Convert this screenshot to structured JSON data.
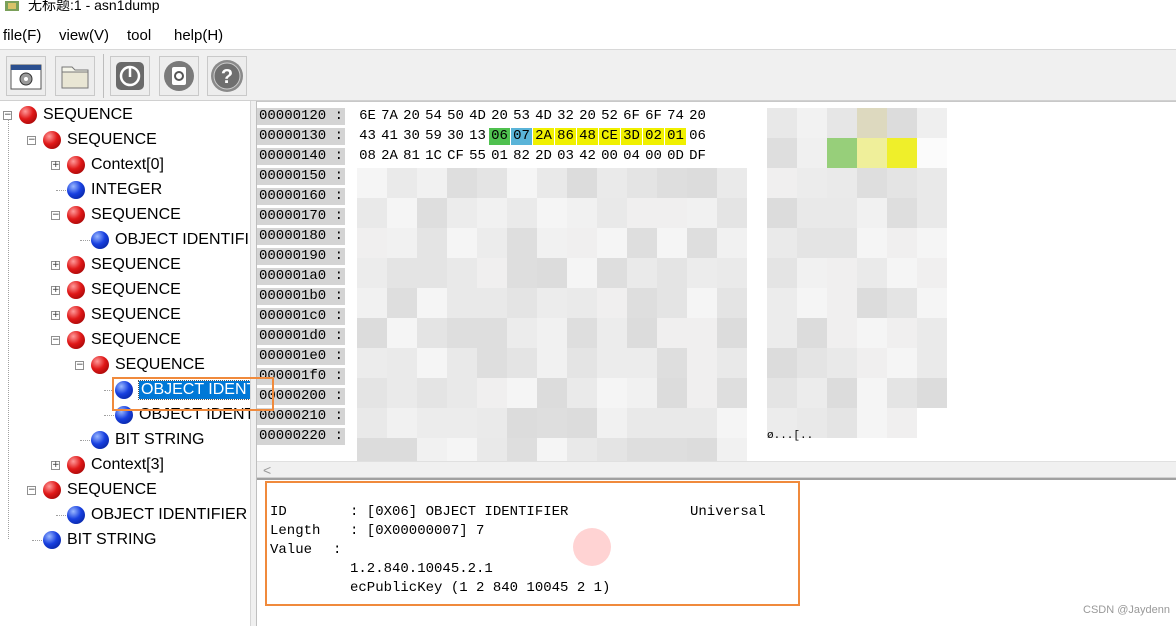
{
  "window": {
    "title": "无标题:1 - asn1dump"
  },
  "menu": [
    "file(F)",
    "view(V)",
    "tool",
    "help(H)"
  ],
  "toolbar": {
    "buttons": [
      {
        "icon": "settings-window-icon"
      },
      {
        "icon": "folder-icon"
      },
      {
        "icon": "power-icon"
      },
      {
        "icon": "recycle-icon"
      },
      {
        "icon": "help-icon"
      }
    ]
  },
  "tree": [
    {
      "label": "SEQUENCE",
      "color": "red",
      "level": 0,
      "expander": "-"
    },
    {
      "label": "SEQUENCE",
      "color": "red",
      "level": 1,
      "expander": "-"
    },
    {
      "label": "Context[0]",
      "color": "red",
      "level": 2,
      "expander": "+"
    },
    {
      "label": "INTEGER",
      "color": "blue",
      "level": 2,
      "expander": ""
    },
    {
      "label": "SEQUENCE",
      "color": "red",
      "level": 2,
      "expander": "-"
    },
    {
      "label": "OBJECT IDENTIFIE",
      "color": "blue",
      "level": 3,
      "expander": ""
    },
    {
      "label": "SEQUENCE",
      "color": "red",
      "level": 2,
      "expander": "+"
    },
    {
      "label": "SEQUENCE",
      "color": "red",
      "level": 2,
      "expander": "+"
    },
    {
      "label": "SEQUENCE",
      "color": "red",
      "level": 2,
      "expander": "+"
    },
    {
      "label": "SEQUENCE",
      "color": "red",
      "level": 2,
      "expander": "-"
    },
    {
      "label": "SEQUENCE",
      "color": "red",
      "level": 3,
      "expander": "-"
    },
    {
      "label": "OBJECT IDENT",
      "color": "blue",
      "level": 4,
      "expander": "",
      "selected": true
    },
    {
      "label": "OBJECT IDENT",
      "color": "blue",
      "level": 4,
      "expander": ""
    },
    {
      "label": "BIT STRING",
      "color": "blue",
      "level": 3,
      "expander": ""
    },
    {
      "label": "Context[3]",
      "color": "red",
      "level": 2,
      "expander": "+"
    },
    {
      "label": "SEQUENCE",
      "color": "red",
      "level": 1,
      "expander": "-"
    },
    {
      "label": "OBJECT IDENTIFIER",
      "color": "blue",
      "level": 2,
      "expander": ""
    },
    {
      "label": "BIT STRING",
      "color": "blue",
      "level": 1,
      "expander": ""
    }
  ],
  "hex": {
    "addresses": [
      "00000120 :",
      "00000130 :",
      "00000140 :",
      "00000150 :",
      "00000160 :",
      "00000170 :",
      "00000180 :",
      "00000190 :",
      "000001a0 :",
      "000001b0 :",
      "000001c0 :",
      "000001d0 :",
      "000001e0 :",
      "000001f0 :",
      "00000200 :",
      "00000210 :",
      "00000220 :"
    ],
    "rows": [
      [
        {
          "b": "6E"
        },
        {
          "b": "7A"
        },
        {
          "b": "20"
        },
        {
          "b": "54"
        },
        {
          "b": "50"
        },
        {
          "b": "4D"
        },
        {
          "b": "20"
        },
        {
          "b": "53"
        },
        {
          "b": "4D"
        },
        {
          "b": "32"
        },
        {
          "b": "20"
        },
        {
          "b": "52"
        },
        {
          "b": "6F"
        },
        {
          "b": "6F"
        },
        {
          "b": "74"
        },
        {
          "b": "20"
        }
      ],
      [
        {
          "b": "43"
        },
        {
          "b": "41"
        },
        {
          "b": "30"
        },
        {
          "b": "59"
        },
        {
          "b": "30"
        },
        {
          "b": "13"
        },
        {
          "b": "06",
          "hl": "green"
        },
        {
          "b": "07",
          "hl": "blue"
        },
        {
          "b": "2A",
          "hl": "yellow"
        },
        {
          "b": "86",
          "hl": "yellow"
        },
        {
          "b": "48",
          "hl": "yellow"
        },
        {
          "b": "CE",
          "hl": "yellow"
        },
        {
          "b": "3D",
          "hl": "yellow"
        },
        {
          "b": "02",
          "hl": "yellow"
        },
        {
          "b": "01",
          "hl": "yellow"
        },
        {
          "b": "06"
        }
      ],
      [
        {
          "b": "08"
        },
        {
          "b": "2A"
        },
        {
          "b": "81"
        },
        {
          "b": "1C"
        },
        {
          "b": "CF"
        },
        {
          "b": "55"
        },
        {
          "b": "01"
        },
        {
          "b": "82"
        },
        {
          "b": "2D"
        },
        {
          "b": "03"
        },
        {
          "b": "42"
        },
        {
          "b": "00"
        },
        {
          "b": "04"
        },
        {
          "b": "00"
        },
        {
          "b": "0D"
        },
        {
          "b": "DF"
        }
      ]
    ],
    "ascii_tail": "ø...[..",
    "highlight_colors": {
      "green": "#4fc14f",
      "blue": "#5ab4d8",
      "yellow": "#f0f000"
    }
  },
  "detail": {
    "id_label": "ID",
    "id_value": ": [0X06] OBJECT IDENTIFIER",
    "id_class": "Universal",
    "length_label": "Length",
    "length_value": ": [0X00000007] 7",
    "value_label": "Value",
    "value_colon": ":",
    "oid": "1.2.840.10045.2.1",
    "oid_name": "ecPublicKey (1 2 840 10045 2 1)"
  },
  "watermark": "CSDN @Jaydenn",
  "colors": {
    "accent_box": "#f08a3c",
    "selection": "#0078d7"
  }
}
